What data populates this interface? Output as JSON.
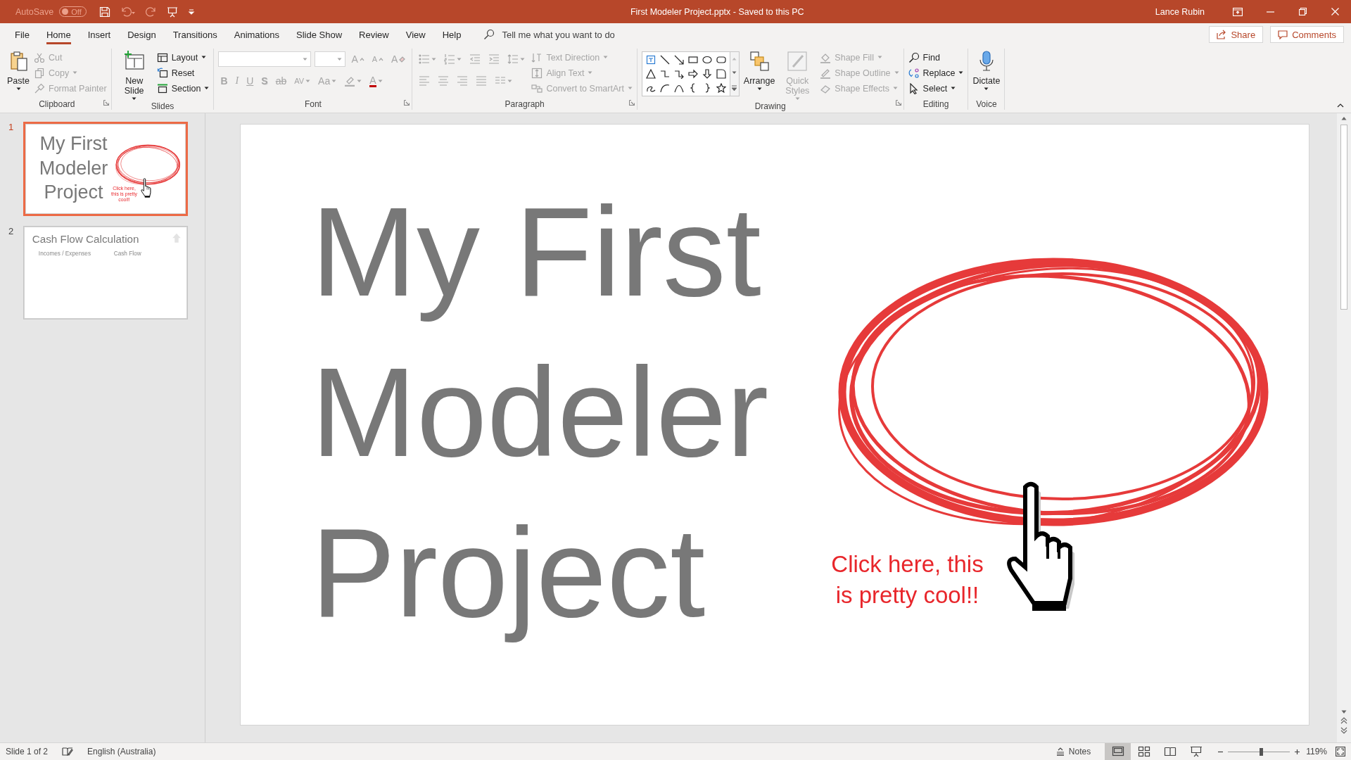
{
  "title_bar": {
    "autosave": {
      "label": "AutoSave",
      "state": "Off",
      "on": false
    },
    "document_title": "First Modeler Project.pptx  -  Saved to this PC",
    "user": "Lance Rubin"
  },
  "menu_tabs": [
    {
      "label": "File",
      "selected": false
    },
    {
      "label": "Home",
      "selected": true
    },
    {
      "label": "Insert",
      "selected": false
    },
    {
      "label": "Design",
      "selected": false
    },
    {
      "label": "Transitions",
      "selected": false
    },
    {
      "label": "Animations",
      "selected": false
    },
    {
      "label": "Slide Show",
      "selected": false
    },
    {
      "label": "Review",
      "selected": false
    },
    {
      "label": "View",
      "selected": false
    },
    {
      "label": "Help",
      "selected": false
    }
  ],
  "tell_me": {
    "placeholder": "Tell me what you want to do"
  },
  "share_button": "Share",
  "comments_button": "Comments",
  "ribbon_groups": [
    {
      "name": "Clipboard",
      "launcher": true,
      "items": [
        {
          "kind": "large",
          "label": "Paste",
          "disabled": false,
          "menu": true
        },
        {
          "kind": "small",
          "label": "Cut",
          "disabled": true,
          "menu": false
        },
        {
          "kind": "small",
          "label": "Copy",
          "disabled": true,
          "menu": true
        },
        {
          "kind": "small",
          "label": "Format Painter",
          "disabled": true,
          "menu": false
        }
      ]
    },
    {
      "name": "Slides",
      "launcher": false,
      "items": [
        {
          "kind": "large",
          "label": "New Slide",
          "disabled": false,
          "menu": true
        },
        {
          "kind": "small",
          "label": "Layout",
          "disabled": false,
          "menu": true
        },
        {
          "kind": "small",
          "label": "Reset",
          "disabled": false,
          "menu": false
        },
        {
          "kind": "small",
          "label": "Section",
          "disabled": false,
          "menu": true
        }
      ]
    },
    {
      "name": "Font",
      "launcher": true,
      "items": [
        {
          "kind": "toolrow",
          "buttons": [
            {
              "kind": "field",
              "disabled": true,
              "menu": true
            },
            {
              "kind": "field",
              "disabled": true,
              "menu": true
            },
            {
              "kind": "button",
              "label": "A",
              "disabled": true,
              "menu": false
            },
            {
              "kind": "button",
              "label": "A",
              "disabled": true,
              "menu": false
            },
            {
              "kind": "button",
              "label": "A",
              "disabled": true,
              "menu": false
            }
          ]
        },
        {
          "kind": "toolrow",
          "buttons": [
            {
              "kind": "button",
              "label": "B",
              "disabled": true,
              "menu": false
            },
            {
              "kind": "button",
              "label": "I",
              "disabled": true,
              "menu": false
            },
            {
              "kind": "button",
              "label": "U",
              "disabled": true,
              "menu": false
            },
            {
              "kind": "button",
              "label": "S",
              "disabled": true,
              "menu": false
            },
            {
              "kind": "button",
              "label": "ab",
              "disabled": true,
              "menu": false
            },
            {
              "kind": "button",
              "label": "AV",
              "disabled": true,
              "menu": true
            },
            {
              "kind": "button",
              "label": "Aa",
              "disabled": true,
              "menu": true
            },
            {
              "kind": "button",
              "disabled": true,
              "menu": true
            },
            {
              "kind": "button",
              "label": "A",
              "disabled": true,
              "menu": true
            }
          ]
        }
      ]
    },
    {
      "name": "Paragraph",
      "launcher": true,
      "items": [
        {
          "kind": "toolrow",
          "buttons": [
            {
              "kind": "button",
              "disabled": true,
              "menu": true
            },
            {
              "kind": "button",
              "disabled": true,
              "menu": true
            },
            {
              "kind": "button",
              "disabled": true,
              "menu": false
            },
            {
              "kind": "button",
              "disabled": true,
              "menu": false
            },
            {
              "kind": "button",
              "disabled": true,
              "menu": true
            }
          ]
        },
        {
          "kind": "toolrow",
          "buttons": [
            {
              "kind": "button",
              "disabled": true,
              "menu": false
            },
            {
              "kind": "button",
              "disabled": true,
              "menu": false
            },
            {
              "kind": "button",
              "disabled": true,
              "menu": false
            },
            {
              "kind": "button",
              "disabled": true,
              "menu": false
            },
            {
              "kind": "button",
              "disabled": true,
              "menu": true
            }
          ]
        },
        {
          "kind": "small",
          "label": "Text Direction",
          "disabled": true,
          "menu": true
        },
        {
          "kind": "small",
          "label": "Align Text",
          "disabled": true,
          "menu": true
        },
        {
          "kind": "small",
          "label": "Convert to SmartArt",
          "disabled": true,
          "menu": true
        }
      ]
    },
    {
      "name": "Drawing",
      "launcher": true,
      "items": [
        {
          "kind": "gallery"
        },
        {
          "kind": "large",
          "label": "Arrange",
          "disabled": false,
          "menu": true
        },
        {
          "kind": "large",
          "label": "Quick Styles",
          "disabled": true,
          "menu": true
        },
        {
          "kind": "small",
          "label": "Shape Fill",
          "disabled": true,
          "menu": true
        },
        {
          "kind": "small",
          "label": "Shape Outline",
          "disabled": true,
          "menu": true
        },
        {
          "kind": "small",
          "label": "Shape Effects",
          "disabled": true,
          "menu": true
        }
      ]
    },
    {
      "name": "Editing",
      "launcher": false,
      "items": [
        {
          "kind": "small",
          "label": "Find",
          "disabled": false,
          "menu": false
        },
        {
          "kind": "small",
          "label": "Replace",
          "disabled": false,
          "menu": true
        },
        {
          "kind": "small",
          "label": "Select",
          "disabled": false,
          "menu": true
        }
      ]
    },
    {
      "name": "Voice",
      "launcher": false,
      "items": [
        {
          "kind": "large",
          "label": "Dictate",
          "disabled": false,
          "menu": true
        }
      ]
    }
  ],
  "slides": [
    {
      "number": "1",
      "selected": true,
      "kind": "title-callout",
      "title": "My First Modeler Project",
      "callout": "Click here, this is pretty cool!!"
    },
    {
      "number": "2",
      "selected": false,
      "kind": "title-table",
      "title": "Cash Flow Calculation",
      "labels": [
        "Incomes / Expenses",
        "Cash Flow"
      ]
    }
  ],
  "current_slide": {
    "kind": "title-callout",
    "title": "My First Modeler Project",
    "callout": "Click here, this is pretty cool!!"
  },
  "status_bar": {
    "slide_info": "Slide 1 of 2",
    "language": "English (Australia)",
    "notes_button": "Notes",
    "views": [
      {
        "selected": true
      },
      {
        "selected": false
      },
      {
        "selected": false
      },
      {
        "selected": false
      }
    ],
    "zoom": {
      "level": 0.53,
      "reading": "119%"
    }
  }
}
